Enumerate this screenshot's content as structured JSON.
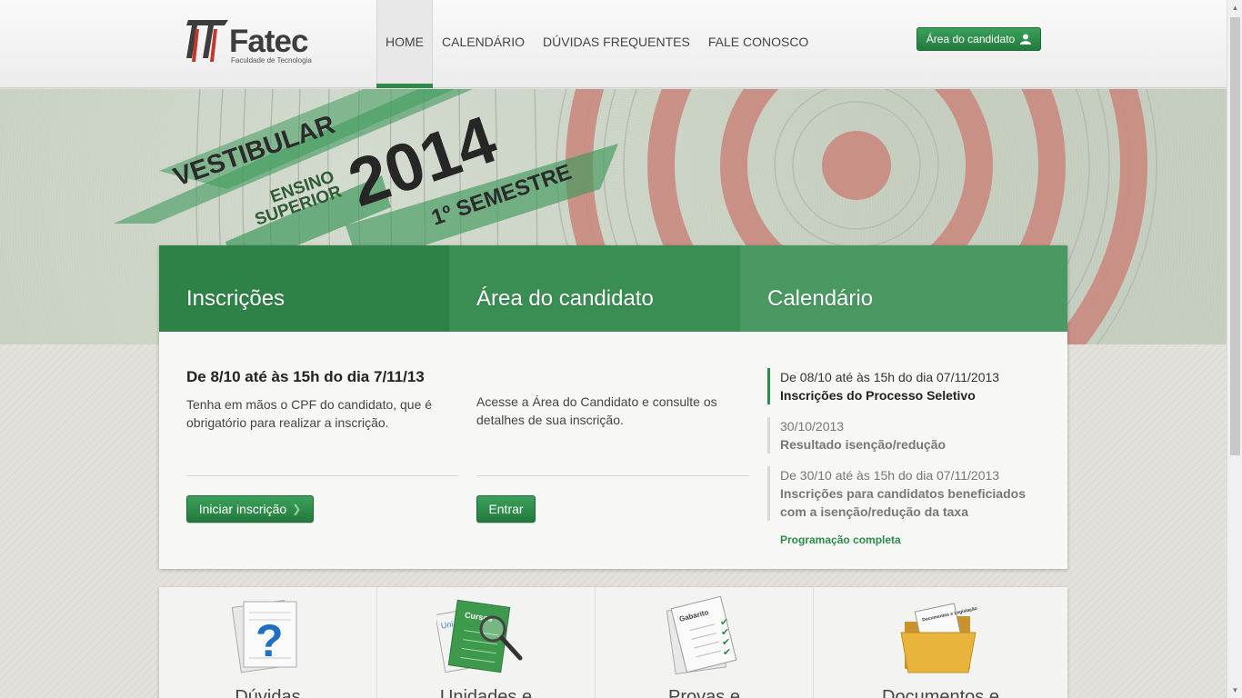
{
  "header": {
    "logo_text": "Fatec",
    "logo_subtitle": "Faculdade de Tecnologia",
    "nav": [
      "HOME",
      "CALENDÁRIO",
      "DÚVIDAS FREQUENTES",
      "FALE CONOSCO"
    ],
    "active_nav": "HOME",
    "area_button": "Área do candidato",
    "area_button_icon": "user-icon"
  },
  "hero": {
    "line1": "VESTIBULAR",
    "line2a": "ENSINO",
    "line2b": "SUPERIOR",
    "year": "2014",
    "semester": "1º SEMESTRE"
  },
  "card": {
    "tabs": [
      "Inscrições",
      "Área do candidato",
      "Calendário"
    ],
    "inscricoes": {
      "title": "De 8/10 até às 15h do dia 7/11/13",
      "text": "Tenha em mãos o CPF do candidato, que é obrigatório para realizar a inscrição.",
      "button": "Iniciar inscrição",
      "button_icon": "chevron-right-icon"
    },
    "area": {
      "text": "Acesse a Área do Candidato e consulte os detalhes de sua inscrição.",
      "button": "Entrar"
    },
    "calendario": {
      "items": [
        {
          "date": "De 08/10 até às 15h do dia 07/11/2013",
          "title": "Inscrições do Processo Seletivo",
          "current": true
        },
        {
          "date": "30/10/2013",
          "title": "Resultado isenção/redução",
          "current": false
        },
        {
          "date": "De 30/10 até às 15h do dia 07/11/2013",
          "title": "Inscrições para candidatos beneficiados com a isenção/redução da taxa",
          "current": false
        }
      ],
      "link": "Programação completa"
    }
  },
  "bottom_cards": [
    {
      "label": "Dúvidas",
      "icon": "question-document-icon"
    },
    {
      "label": "Unidades e",
      "icon": "courses-list-magnifier-icon"
    },
    {
      "label": "Provas e",
      "icon": "answer-sheet-icon"
    },
    {
      "label": "Documentos e",
      "icon": "folder-documents-icon"
    }
  ],
  "bottom_mini_text": {
    "courses_label": "Cursos",
    "gabarito_label": "Gabarito",
    "legislacao_label": "Documentos e Legislação"
  },
  "colors": {
    "brand_green": "#2e8a4a",
    "logo_red": "#c0392b",
    "target_red": "#c98a80"
  }
}
